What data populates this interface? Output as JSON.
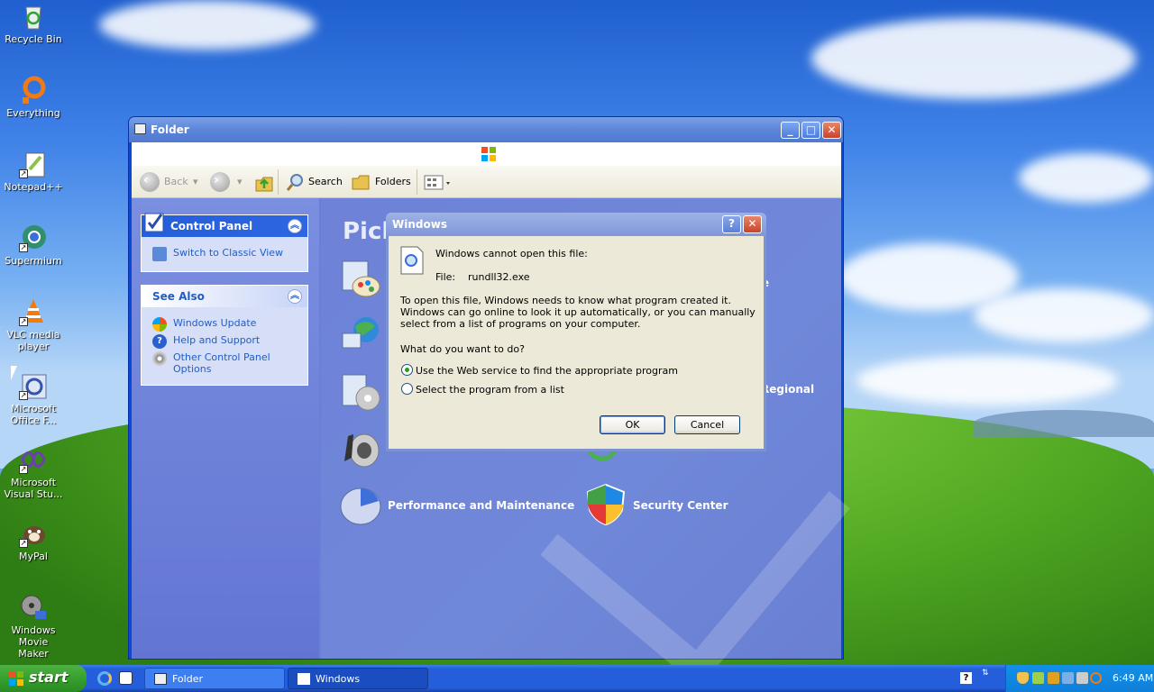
{
  "desktop": {
    "icons": [
      {
        "name": "recycle-bin",
        "label": "Recycle Bin"
      },
      {
        "name": "everything",
        "label": "Everything"
      },
      {
        "name": "notepadpp",
        "label": "Notepad++"
      },
      {
        "name": "supermium",
        "label": "Supermium"
      },
      {
        "name": "vlc",
        "label": "VLC media player"
      },
      {
        "name": "ms-office",
        "label": "Microsoft Office F..."
      },
      {
        "name": "ms-visual-studio",
        "label": "Microsoft Visual Stu..."
      },
      {
        "name": "mypal",
        "label": "MyPal"
      },
      {
        "name": "movie-maker",
        "label": "Windows Movie Maker"
      }
    ]
  },
  "folder_window": {
    "title": "Folder",
    "toolbar": {
      "back": "Back",
      "search": "Search",
      "folders": "Folders"
    },
    "task_pane": {
      "control_panel": {
        "title": "Control Panel",
        "links": [
          "Switch to Classic View"
        ]
      },
      "see_also": {
        "title": "See Also",
        "links": [
          "Windows Update",
          "Help and Support",
          "Other Control Panel Options"
        ]
      }
    },
    "main": {
      "pick_heading": "Pick",
      "categories": [
        {
          "label": "re"
        },
        {
          "label": "Regional"
        },
        {
          "label": "Performance and Maintenance"
        },
        {
          "label": "Security Center"
        }
      ]
    }
  },
  "dialog": {
    "title": "Windows",
    "message": "Windows cannot open this file:",
    "file_label": "File:",
    "file_name": "rundll32.exe",
    "explanation": "To open this file, Windows needs to know what program created it.  Windows can go online to look it up automatically, or you can manually select from a list of programs on your computer.",
    "question": "What do you want to do?",
    "options": [
      {
        "label": "Use the Web service to find the appropriate program",
        "selected": true
      },
      {
        "label": "Select the program from a list",
        "selected": false
      }
    ],
    "ok": "OK",
    "cancel": "Cancel"
  },
  "taskbar": {
    "start": "start",
    "tasks": [
      {
        "label": "Folder",
        "active": false
      },
      {
        "label": "Windows",
        "active": true
      }
    ],
    "clock": "6:49 AM"
  },
  "colors": {
    "xp_blue": "#245edb",
    "start_green": "#36a02d",
    "task_pane_link": "#215dc6"
  }
}
